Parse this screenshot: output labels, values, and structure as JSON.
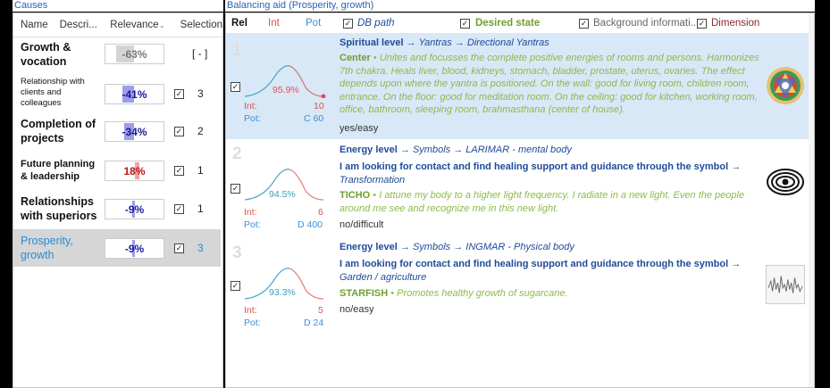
{
  "causes": {
    "title": "Causes",
    "columns": {
      "name": "Name",
      "descr": "Descri...",
      "relevance": "Relevance",
      "selection": "Selection"
    },
    "rows": [
      {
        "name": "Growth & vocation",
        "relevance": "-63%",
        "selection": "[ - ]",
        "checked": false,
        "relevance_fraction": 0.63,
        "bar_color": "#d4d4d4",
        "text_color": "#777777"
      },
      {
        "name": "Relationship with clients and colleagues",
        "relevance": "-41%",
        "selection": "3",
        "checked": true,
        "relevance_fraction": 0.41,
        "bar_color": "#9d9de8",
        "text_color": "#1a1a99"
      },
      {
        "name": "Completion of projects",
        "relevance": "-34%",
        "selection": "2",
        "checked": true,
        "relevance_fraction": 0.34,
        "bar_color": "#9d9de8",
        "text_color": "#1a1a99"
      },
      {
        "name": "Future planning & leadership",
        "relevance": "18%",
        "selection": "1",
        "checked": true,
        "relevance_fraction": 0.18,
        "bar_color": "#f3a0a0",
        "text_color": "#b01818"
      },
      {
        "name": "Relationships with superiors",
        "relevance": "-9%",
        "selection": "1",
        "checked": true,
        "relevance_fraction": 0.09,
        "bar_color": "#9d9de8",
        "text_color": "#1a1a99"
      },
      {
        "name": "Prosperity, growth",
        "relevance": "-9%",
        "selection": "3",
        "checked": true,
        "relevance_fraction": 0.09,
        "bar_color": "#9d9de8",
        "text_color": "#1a1a99"
      }
    ]
  },
  "aid": {
    "title": "Balancing aid (Prosperity, growth)",
    "columns": {
      "rel": "Rel",
      "int": "Int",
      "pot": "Pot",
      "db_path": "DB path",
      "desired_state": "Desired state",
      "background": "Background informati...",
      "dimension": "Dimension"
    },
    "rows": [
      {
        "num": "1",
        "pct": "95.9%",
        "int_label": "Int:",
        "int_val": "10",
        "pot_label": "Pot:",
        "pot_val": "C 60",
        "level": "Spiritual level",
        "arrow": "→",
        "path1": "Yantras",
        "path2": "Directional Yantras",
        "desired": "",
        "name": "Center",
        "bullet": " • ",
        "text": "Unites and focusses the complete positive energies of rooms and persons. Harmonizes 7th chakra. Heals liver, blood, kidneys, stomach, bladder, prostate, uterus, ovaries. The effect depends upon where the yantra is positioned. On the wall: good for living room, children room, entrance. On the floor: good for meditation room. On the ceiling: good for kitchen, working room, office, bathroom, sleeping room, brahmasthana (center of house).",
        "note": "yes/easy",
        "icon": "mandala-icon"
      },
      {
        "num": "2",
        "pct": "94.5%",
        "int_label": "Int:",
        "int_val": "6",
        "pot_label": "Pot:",
        "pot_val": "D 400",
        "level": "Energy level",
        "arrow": "→",
        "path1": "Symbols",
        "path2": "LARIMAR - mental body",
        "desired": "I am looking for contact and find healing support and guidance through the symbol",
        "desired_end": "Transformation",
        "name": "TICHO",
        "bullet": " • ",
        "text": "I attune my body to a higher light frequency. I radiate in a new light. Even the people around me see and recognize me in this new light.",
        "note": "no/difficult",
        "icon": "eye-symbol-icon"
      },
      {
        "num": "3",
        "pct": "93.3%",
        "int_label": "Int:",
        "int_val": "5",
        "pot_label": "Pot:",
        "pot_val": "D 24",
        "level": "Energy level",
        "arrow": "→",
        "path1": "Symbols",
        "path2": "INGMAR - Physical body",
        "desired": "I am looking for contact and find healing support and guidance through the symbol",
        "desired_end": "Garden / agriculture",
        "name": "STARFISH",
        "bullet": " • ",
        "text": "Promotes healthy growth of sugarcane.",
        "note": "no/easy",
        "icon": "waveform-icon"
      }
    ]
  }
}
